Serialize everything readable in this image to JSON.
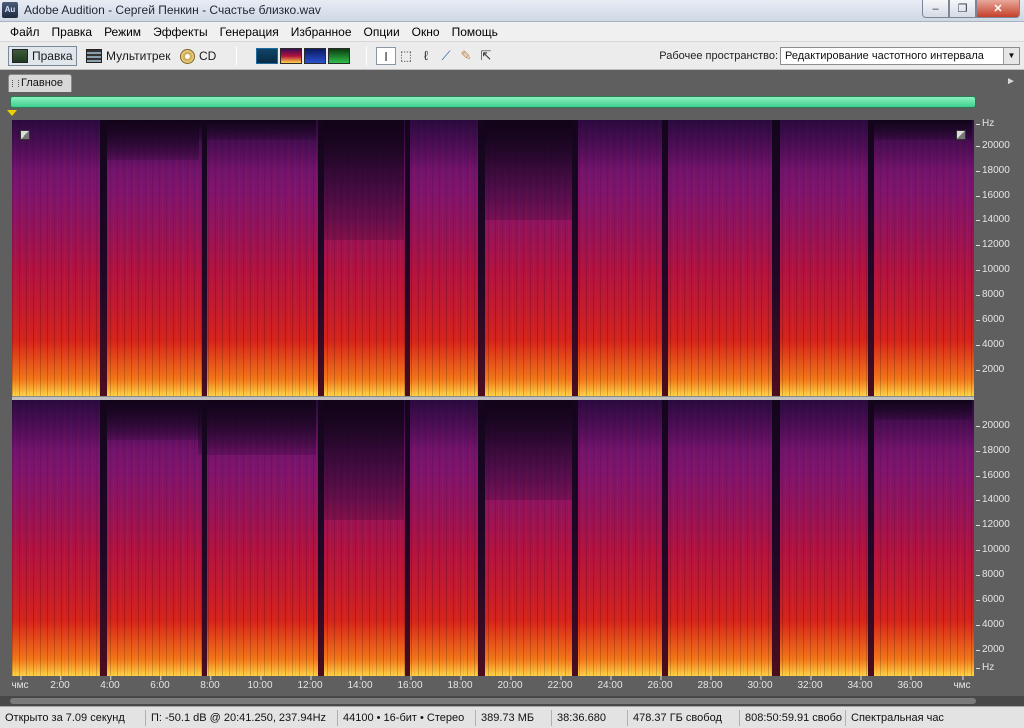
{
  "window": {
    "app_icon_label": "Au",
    "title": "Adobe Audition - Сергей Пенкин - Счастье близко.wav",
    "minimize": "–",
    "restore": "❐",
    "close": "✕"
  },
  "menu": [
    "Файл",
    "Правка",
    "Режим",
    "Эффекты",
    "Генерация",
    "Избранное",
    "Опции",
    "Окно",
    "Помощь"
  ],
  "toolbar": {
    "edit_label": "Правка",
    "multitrack_label": "Мультитрек",
    "cd_label": "CD",
    "workspace_label": "Рабочее пространство:",
    "workspace_value": "Редактирование частотного интервала"
  },
  "panel": {
    "tab_label": "Главное",
    "menu_icon": "►"
  },
  "freq_axis": {
    "unit": "Hz",
    "ticks": [
      "20000",
      "18000",
      "16000",
      "14000",
      "12000",
      "10000",
      "8000",
      "6000",
      "4000",
      "2000"
    ],
    "bottom_unit": "Hz"
  },
  "time_axis": {
    "start": "чмс",
    "ticks": [
      "2:00",
      "4:00",
      "6:00",
      "8:00",
      "10:00",
      "12:00",
      "14:00",
      "16:00",
      "18:00",
      "20:00",
      "22:00",
      "24:00",
      "26:00",
      "28:00",
      "30:00",
      "32:00",
      "34:00",
      "36:00"
    ],
    "end": "чмс"
  },
  "status": {
    "opened": "Открыто за 7.09 секунд",
    "cursor": "П: -50.1 dB @ 20:41.250, 237.94Hz",
    "format": "44100 • 16-бит • Стерео",
    "size": "389.73 МБ",
    "duration": "38:36.680",
    "disk_free": "478.37 ГБ свобод",
    "time_free": "808:50:59.91 свобо",
    "view": "Спектральная час"
  },
  "colors": {
    "overview": "#3fcf8e",
    "spectrogram_low": "#ffd447",
    "spectrogram_mid": "#b0123d",
    "spectrogram_high": "#3a0c52"
  }
}
